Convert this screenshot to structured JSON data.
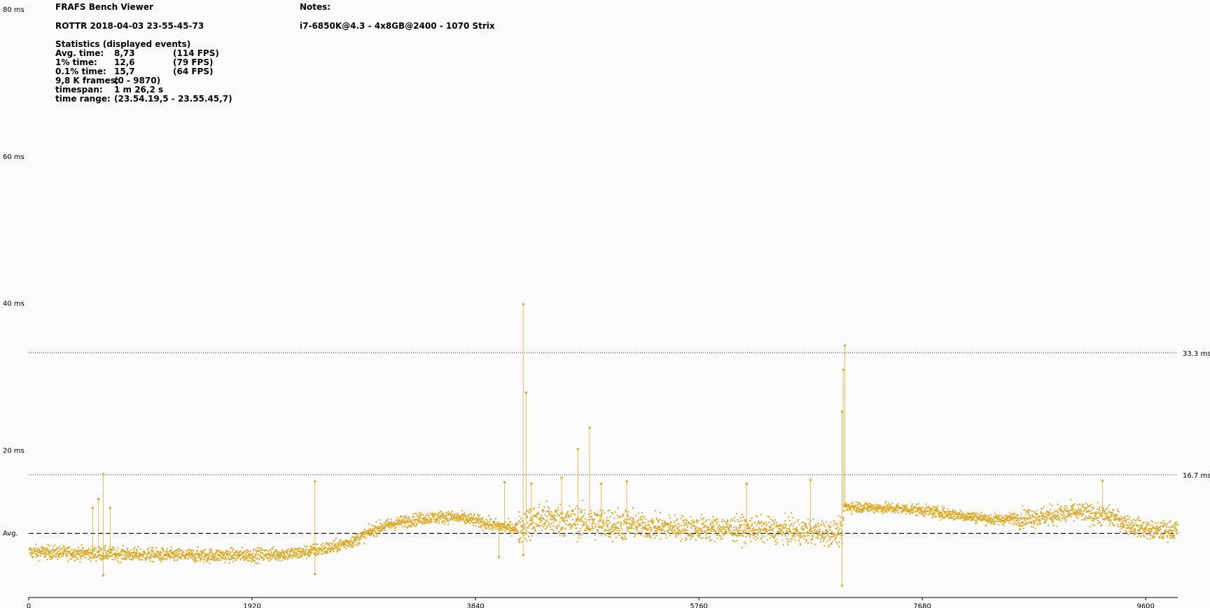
{
  "header": {
    "app_title": "FRAFS Bench Viewer",
    "run_name": "ROTTR 2018-04-03 23-55-45-73",
    "notes_label": "Notes:",
    "notes_text": "i7-6850K@4.3 - 4x8GB@2400 - 1070 Strix"
  },
  "stats": {
    "title": "Statistics (displayed events)",
    "rows": [
      {
        "label": "Avg. time:",
        "value": "8,73",
        "extra": "(114 FPS)"
      },
      {
        "label": "1% time:",
        "value": "12,6",
        "extra": "(79 FPS)"
      },
      {
        "label": "0.1% time:",
        "value": "15,7",
        "extra": "(64 FPS)"
      },
      {
        "label": "9,8 K frames:",
        "value": "(0 - 9870)",
        "extra": ""
      },
      {
        "label": "timespan:",
        "value": "1 m 26,2 s",
        "extra": ""
      },
      {
        "label": "time range:",
        "value": "(23.54.19,5 - 23.55.45,7)",
        "extra": ""
      }
    ]
  },
  "chart_data": {
    "type": "scatter",
    "series_color": "#e0a820",
    "xlim": [
      0,
      9870
    ],
    "ylim": [
      0,
      80
    ],
    "x_ticks": [
      0,
      1920,
      3840,
      5760,
      7680,
      9600
    ],
    "x_tick_labels": [
      "0",
      "1920",
      "3840",
      "5760",
      "7680",
      "9600"
    ],
    "y_ticks": [
      20,
      40,
      60,
      80
    ],
    "y_tick_labels": [
      "20 ms",
      "40 ms",
      "60 ms",
      "80 ms"
    ],
    "reference_lines": [
      {
        "value": 33.3,
        "label": "33.3 ms",
        "style": "dotted"
      },
      {
        "value": 16.7,
        "label": "16.7 ms",
        "style": "dotted"
      },
      {
        "value": 8.73,
        "label": "Avg.",
        "style": "dashed"
      }
    ],
    "trend": [
      [
        0,
        6.2
      ],
      [
        500,
        6.0
      ],
      [
        1000,
        5.8
      ],
      [
        1500,
        5.7
      ],
      [
        2000,
        5.8
      ],
      [
        2300,
        6.0
      ],
      [
        2600,
        6.8
      ],
      [
        2800,
        7.8
      ],
      [
        3000,
        9.5
      ],
      [
        3200,
        10.3
      ],
      [
        3400,
        10.8
      ],
      [
        3600,
        11.0
      ],
      [
        3800,
        10.6
      ],
      [
        4000,
        9.8
      ],
      [
        4200,
        9.4
      ],
      [
        4400,
        10.8
      ],
      [
        4700,
        10.3
      ],
      [
        5000,
        10.0
      ],
      [
        5400,
        9.6
      ],
      [
        5800,
        9.4
      ],
      [
        6200,
        9.3
      ],
      [
        6600,
        9.0
      ],
      [
        6990,
        8.8
      ],
      [
        7000,
        12.4
      ],
      [
        7300,
        12.2
      ],
      [
        7600,
        12.0
      ],
      [
        7800,
        11.6
      ],
      [
        8100,
        11.0
      ],
      [
        8300,
        10.6
      ],
      [
        8700,
        11.0
      ],
      [
        9000,
        11.6
      ],
      [
        9300,
        11.0
      ],
      [
        9500,
        9.6
      ],
      [
        9700,
        9.0
      ],
      [
        9870,
        9.3
      ]
    ],
    "spikes": [
      [
        550,
        12.2
      ],
      [
        600,
        13.4
      ],
      [
        640,
        16.8
      ],
      [
        700,
        12.2
      ],
      [
        2460,
        15.8
      ],
      [
        4090,
        15.7
      ],
      [
        4250,
        39.9
      ],
      [
        4275,
        27.9
      ],
      [
        4320,
        15.5
      ],
      [
        4580,
        16.3
      ],
      [
        4720,
        20.2
      ],
      [
        4820,
        23.1
      ],
      [
        4920,
        15.5
      ],
      [
        5140,
        15.8
      ],
      [
        6170,
        15.5
      ],
      [
        6720,
        16.0
      ],
      [
        6990,
        25.3
      ],
      [
        7000,
        31.0
      ],
      [
        7015,
        34.3
      ],
      [
        9230,
        15.9
      ]
    ],
    "dips": [
      [
        640,
        3.0
      ],
      [
        2460,
        3.2
      ],
      [
        4250,
        5.8
      ],
      [
        6990,
        1.6
      ],
      [
        4040,
        5.5
      ]
    ]
  }
}
